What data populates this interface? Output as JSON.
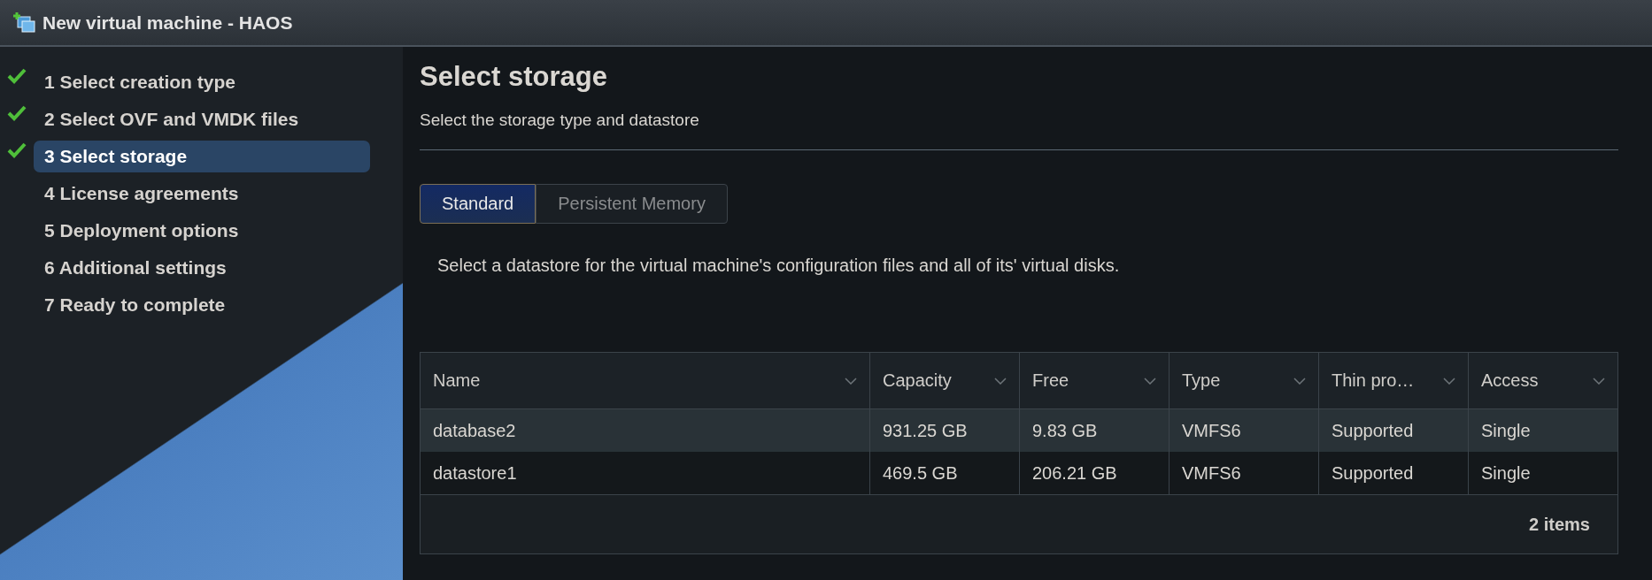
{
  "window": {
    "title": "New virtual machine - HAOS"
  },
  "steps": [
    {
      "label": "1 Select creation type",
      "completed": true,
      "selected": false
    },
    {
      "label": "2 Select OVF and VMDK files",
      "completed": true,
      "selected": false
    },
    {
      "label": "3 Select storage",
      "completed": true,
      "selected": true
    },
    {
      "label": "4 License agreements",
      "completed": false,
      "selected": false
    },
    {
      "label": "5 Deployment options",
      "completed": false,
      "selected": false
    },
    {
      "label": "6 Additional settings",
      "completed": false,
      "selected": false
    },
    {
      "label": "7 Ready to complete",
      "completed": false,
      "selected": false
    }
  ],
  "page": {
    "title": "Select storage",
    "subtitle": "Select the storage type and datastore"
  },
  "tabs": [
    {
      "label": "Standard",
      "selected": true
    },
    {
      "label": "Persistent Memory",
      "selected": false
    }
  ],
  "instruction": "Select a datastore for the virtual machine's configuration files and all of its' virtual disks.",
  "table": {
    "columns": [
      "Name",
      "Capacity",
      "Free",
      "Type",
      "Thin pro…",
      "Access"
    ],
    "rows": [
      {
        "cells": [
          "database2",
          "931.25 GB",
          "9.83 GB",
          "VMFS6",
          "Supported",
          "Single"
        ],
        "selected": true
      },
      {
        "cells": [
          "datastore1",
          "469.5 GB",
          "206.21 GB",
          "VMFS6",
          "Supported",
          "Single"
        ],
        "selected": false
      }
    ],
    "footer": "2 items"
  }
}
